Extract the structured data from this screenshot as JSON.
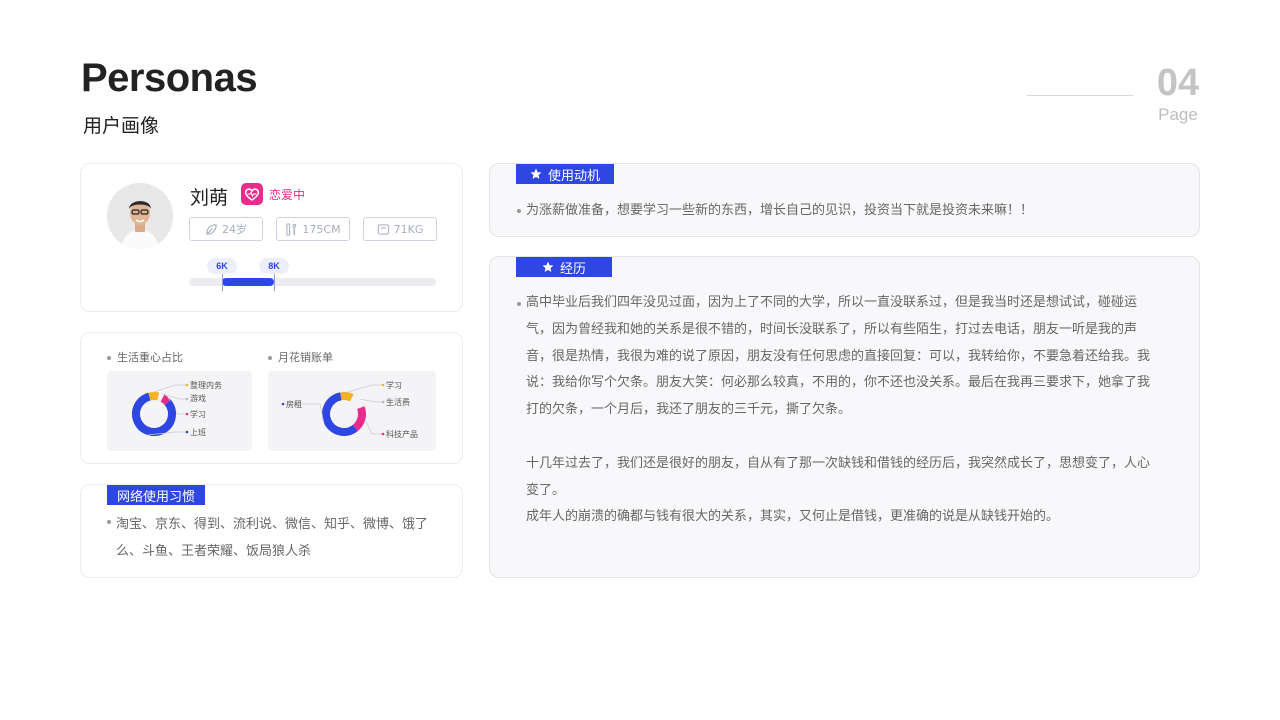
{
  "header": {
    "title_en": "Personas",
    "title_cn": "用户画像",
    "page_number": "04",
    "page_label": "Page"
  },
  "profile": {
    "name": "刘萌",
    "status": "恋爱中",
    "tags": [
      {
        "icon": "leaf-icon",
        "label": "24岁"
      },
      {
        "icon": "height-icon",
        "label": "175CM"
      },
      {
        "icon": "scale-icon",
        "label": "71KG"
      }
    ],
    "income_range": {
      "low_label": "6K",
      "high_label": "8K"
    }
  },
  "charts": {
    "life_focus": {
      "label": "生活重心占比"
    },
    "monthly_bill": {
      "label": "月花销账单"
    }
  },
  "chart_data": [
    {
      "type": "pie",
      "title": "生活重心占比",
      "categories": [
        "整理内务",
        "游戏",
        "学习",
        "上班"
      ],
      "values": [
        8,
        4,
        6,
        82
      ],
      "colors": [
        "#f5b324",
        "#f3f3f5",
        "#ec2c8c",
        "#2e46e2"
      ]
    },
    {
      "type": "pie",
      "title": "月花销账单",
      "categories": [
        "学习",
        "生活费",
        "科技产品",
        "房租"
      ],
      "values": [
        10,
        12,
        20,
        58
      ],
      "colors": [
        "#f5b324",
        "#f3f3f5",
        "#ec2c8c",
        "#2e46e2"
      ]
    }
  ],
  "network": {
    "title": "网络使用习惯",
    "line1": "淘宝、京东、得到、流利说、微信、知乎、微博、饿了",
    "line2": "么、斗鱼、王者荣耀、饭局狼人杀"
  },
  "motivation": {
    "title": "使用动机",
    "text": "为涨薪做准备，想要学习一些新的东西，增长自己的见识，投资当下就是投资未来嘛！！"
  },
  "experience": {
    "title": "经历",
    "lines": [
      "高中毕业后我们四年没见过面，因为上了不同的大学，所以一直没联系过，但是我当时还是想试试，碰碰运",
      "气，因为曾经我和她的关系是很不错的，时间长没联系了，所以有些陌生，打过去电话，朋友一听是我的声",
      "音，很是热情，我很为难的说了原因，朋友没有任何思虑的直接回复：可以，我转给你，不要急着还给我。我",
      "说：我给你写个欠条。朋友大笑：何必那么较真，不用的，你不还也没关系。最后在我再三要求下，她拿了我",
      "打的欠条，一个月后，我还了朋友的三千元，撕了欠条。",
      "",
      "十几年过去了，我们还是很好的朋友，自从有了那一次缺钱和借钱的经历后，我突然成长了，思想变了，人心",
      "变了。",
      "成年人的崩溃的确都与钱有很大的关系，其实，又何止是借钱，更准确的说是从缺钱开始的。"
    ]
  }
}
